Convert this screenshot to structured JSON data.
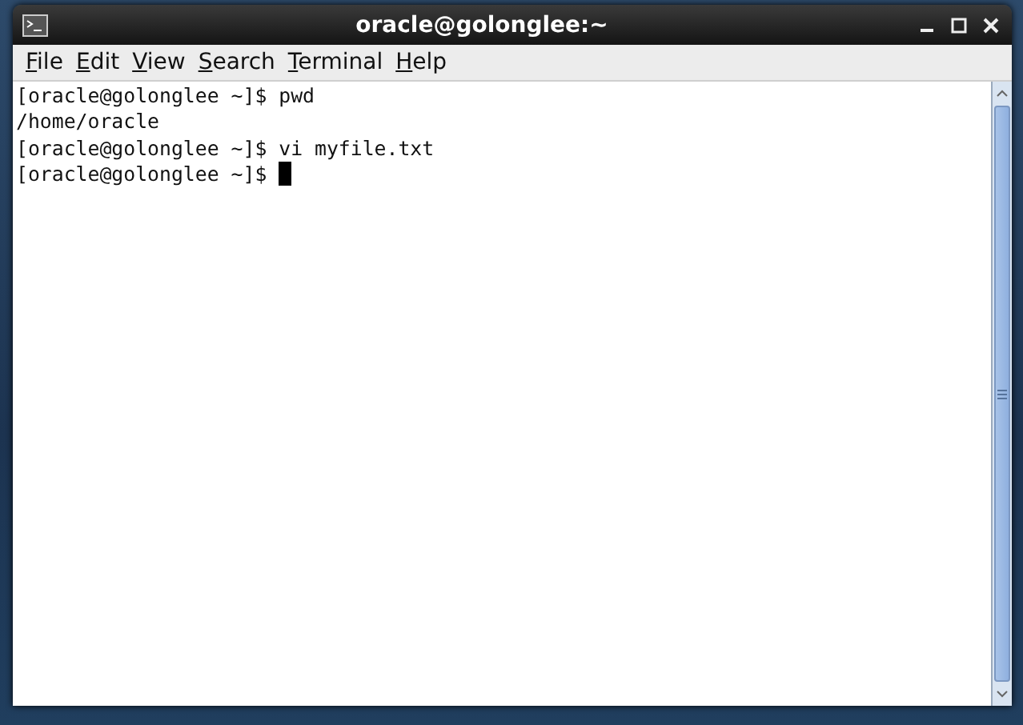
{
  "window": {
    "title": "oracle@golonglee:~"
  },
  "menu": [
    {
      "label": "File"
    },
    {
      "label": "Edit"
    },
    {
      "label": "View"
    },
    {
      "label": "Search"
    },
    {
      "label": "Terminal"
    },
    {
      "label": "Help"
    }
  ],
  "terminal": {
    "lines": [
      "[oracle@golonglee ~]$ pwd",
      "/home/oracle",
      "[oracle@golonglee ~]$ vi myfile.txt",
      "[oracle@golonglee ~]$ "
    ],
    "cursor": true
  }
}
